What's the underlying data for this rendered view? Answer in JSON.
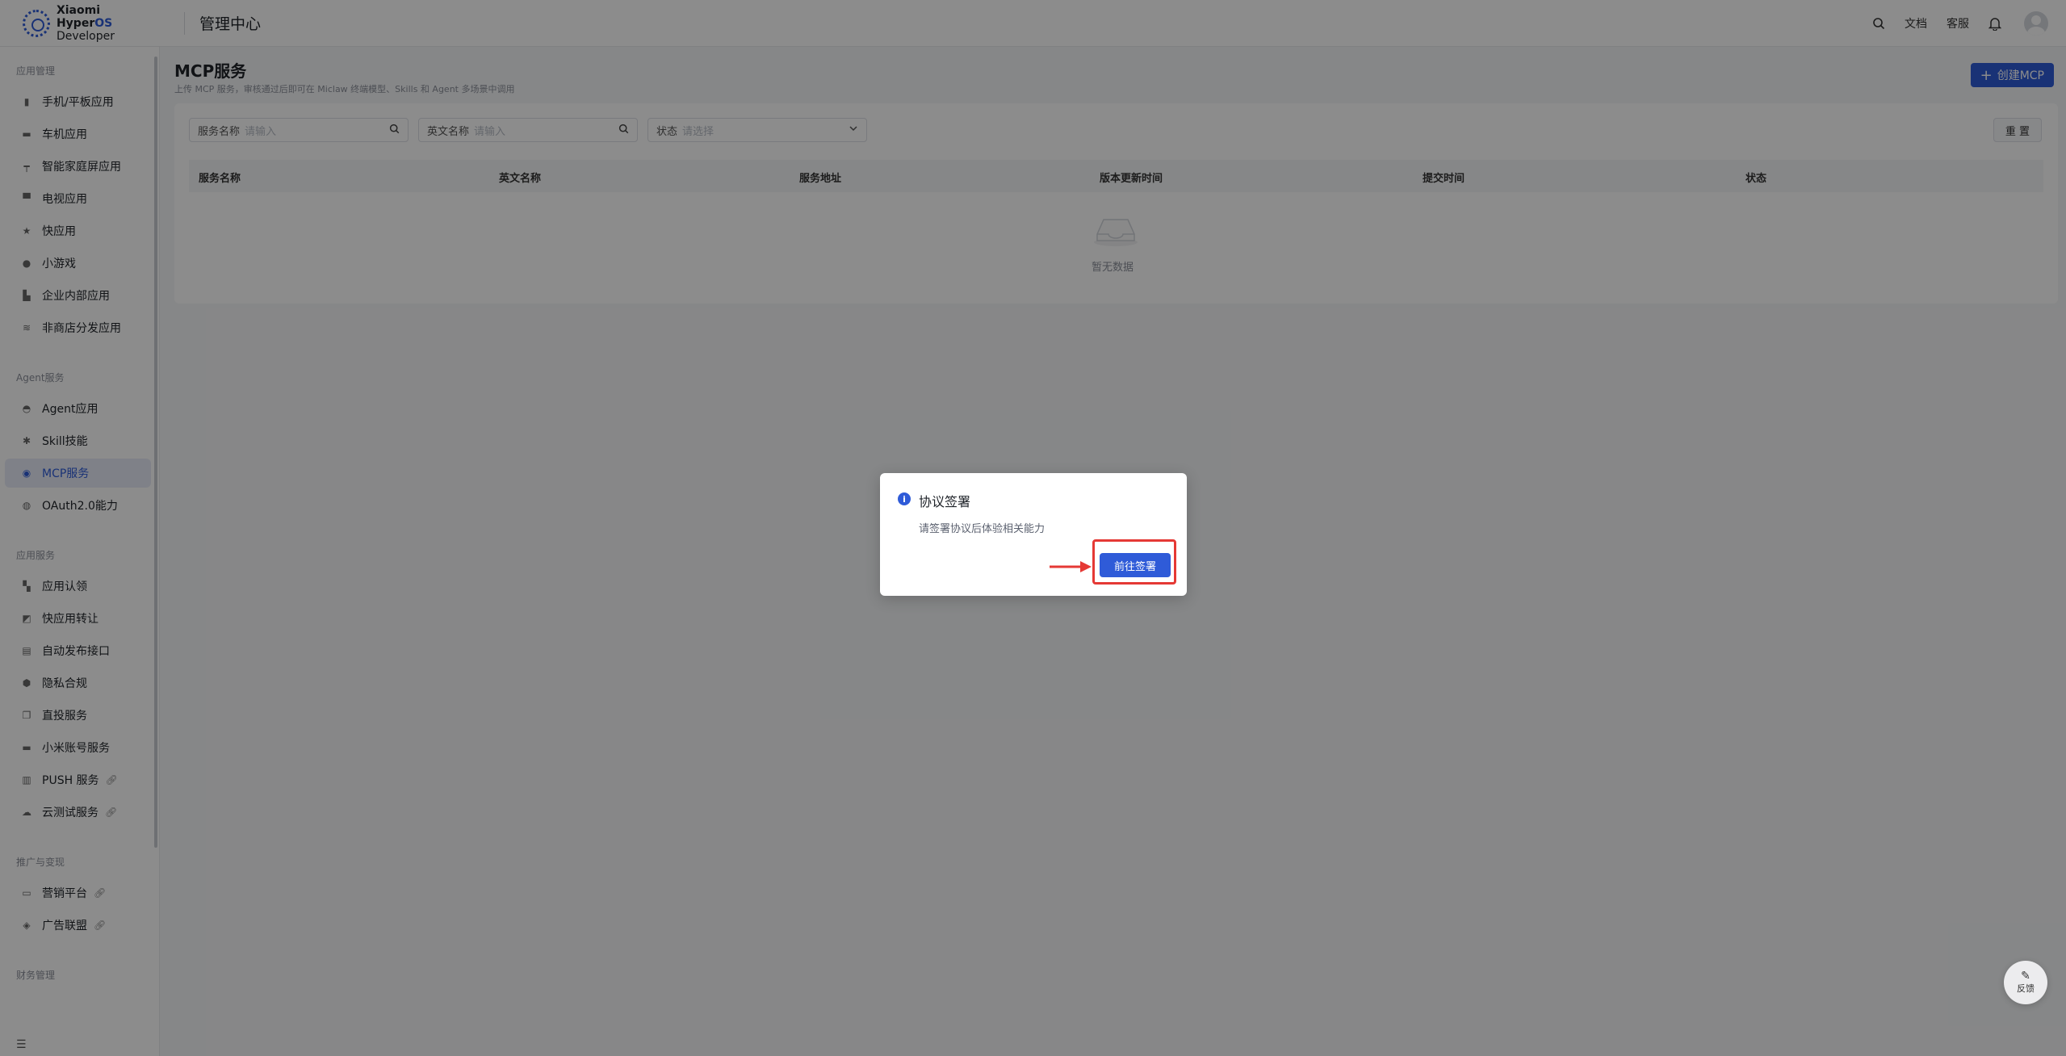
{
  "header": {
    "logo_line1": "Xiaomi Hyper",
    "logo_line1_accent": "OS",
    "logo_line2": "Developer",
    "title": "管理中心",
    "docs": "文档",
    "support": "客服"
  },
  "sidebar": {
    "sections": [
      {
        "title": "应用管理",
        "items": [
          {
            "label": "手机/平板应用",
            "icon": "phone-icon"
          },
          {
            "label": "车机应用",
            "icon": "car-icon"
          },
          {
            "label": "智能家庭屏应用",
            "icon": "home-screen-icon"
          },
          {
            "label": "电视应用",
            "icon": "tv-icon"
          },
          {
            "label": "快应用",
            "icon": "star-icon"
          },
          {
            "label": "小游戏",
            "icon": "gamepad-icon"
          },
          {
            "label": "企业内部应用",
            "icon": "building-icon"
          },
          {
            "label": "非商店分发应用",
            "icon": "layers-icon"
          }
        ]
      },
      {
        "title": "Agent服务",
        "items": [
          {
            "label": "Agent应用",
            "icon": "agent-icon"
          },
          {
            "label": "Skill技能",
            "icon": "skill-icon"
          },
          {
            "label": "MCP服务",
            "icon": "mcp-icon",
            "active": true
          },
          {
            "label": "OAuth2.0能力",
            "icon": "oauth-icon"
          }
        ]
      },
      {
        "title": "应用服务",
        "items": [
          {
            "label": "应用认领",
            "icon": "grid-icon"
          },
          {
            "label": "快应用转让",
            "icon": "transfer-icon"
          },
          {
            "label": "自动发布接口",
            "icon": "publish-icon"
          },
          {
            "label": "隐私合规",
            "icon": "privacy-icon"
          },
          {
            "label": "直投服务",
            "icon": "copy-icon"
          },
          {
            "label": "小米账号服务",
            "icon": "account-icon"
          },
          {
            "label": "PUSH 服务",
            "icon": "push-icon",
            "link": true
          },
          {
            "label": "云测试服务",
            "icon": "cloud-icon",
            "link": true
          }
        ]
      },
      {
        "title": "推广与变现",
        "items": [
          {
            "label": "营销平台",
            "icon": "marketing-icon",
            "link": true
          },
          {
            "label": "广告联盟",
            "icon": "ad-icon",
            "link": true
          }
        ]
      },
      {
        "title": "财务管理",
        "items": []
      }
    ]
  },
  "main": {
    "title": "MCP服务",
    "subtitle": "上传 MCP 服务，审核通过后即可在 Miclaw 终端模型、Skills 和 Agent 多场景中调用",
    "create_button": "创建MCP",
    "filters": [
      {
        "label": "服务名称",
        "placeholder": "请输入"
      },
      {
        "label": "英文名称",
        "placeholder": "请输入"
      },
      {
        "label": "状态",
        "placeholder": "请选择"
      }
    ],
    "reset_button": "重 置",
    "columns": [
      "服务名称",
      "英文名称",
      "服务地址",
      "版本更新时间",
      "提交时间",
      "状态"
    ],
    "empty_text": "暂无数据"
  },
  "dialog": {
    "title": "协议签署",
    "message": "请签署协议后体验相关能力",
    "confirm_button": "前往签署"
  },
  "feedback": {
    "label": "反馈"
  },
  "colors": {
    "primary": "#2f5bd8",
    "highlight": "#e53935"
  }
}
